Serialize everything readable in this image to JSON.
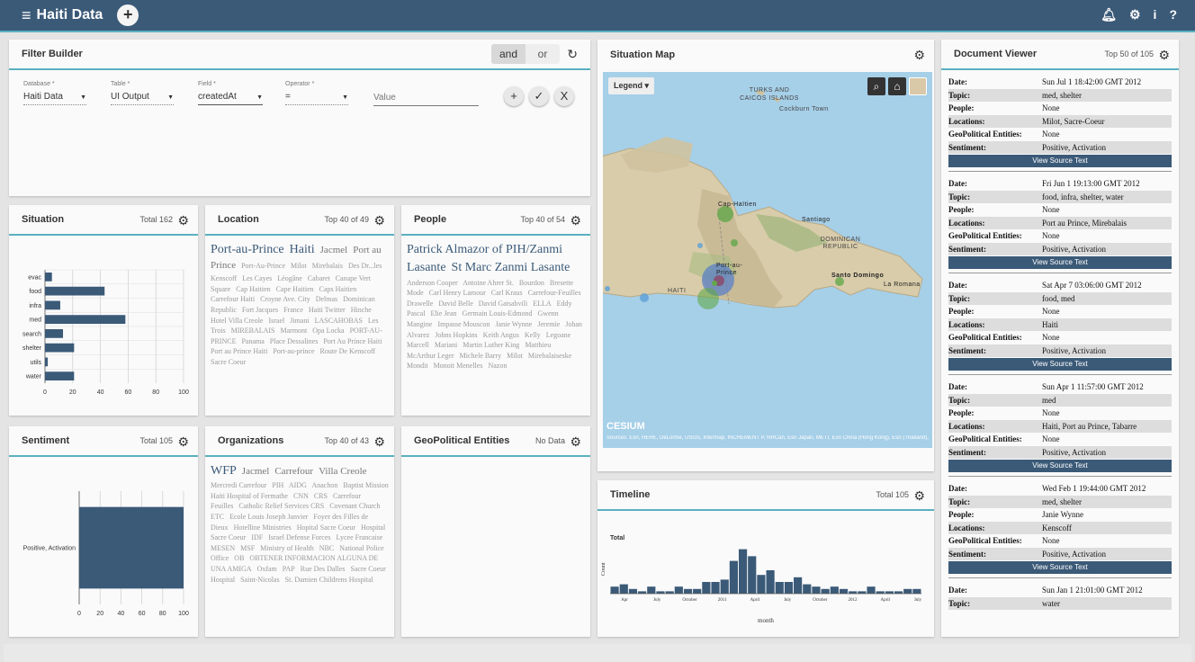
{
  "app": {
    "title": "Haiti Data",
    "menu_icon": "hamburger-icon",
    "add_label": "+",
    "right_icons": [
      "bell-icon",
      "gear-icon",
      "info-icon",
      "help-icon"
    ]
  },
  "filter": {
    "title": "Filter Builder",
    "and_label": "and",
    "or_label": "or",
    "database_label": "Database *",
    "database_value": "Haiti Data",
    "table_label": "Table *",
    "table_value": "UI Output",
    "field_label": "Field *",
    "field_value": "createdAt",
    "operator_label": "Operator *",
    "operator_value": "=",
    "value_placeholder": "Value",
    "add_label": "+",
    "apply_label": "✓",
    "clear_label": "X"
  },
  "situation": {
    "title": "Situation",
    "info": "Total 162",
    "chart_data": {
      "type": "bar",
      "orientation": "horizontal",
      "categories": [
        "evac",
        "food",
        "infra",
        "med",
        "search",
        "shelter",
        "utils",
        "water"
      ],
      "values": [
        5,
        43,
        11,
        58,
        13,
        21,
        2,
        21
      ],
      "xlim": [
        0,
        100
      ],
      "xticks": [
        0,
        20,
        40,
        60,
        80,
        100
      ],
      "color": "#3b5a78"
    }
  },
  "sentiment": {
    "title": "Sentiment",
    "info": "Total 105",
    "chart_data": {
      "type": "bar",
      "orientation": "horizontal",
      "categories": [
        "Positive, Activation"
      ],
      "values": [
        105
      ],
      "xlim": [
        0,
        100
      ],
      "xticks": [
        0,
        20,
        40,
        60,
        80,
        100
      ],
      "color": "#3b5a78"
    }
  },
  "location": {
    "title": "Location",
    "info": "Top 40 of 49",
    "big": [
      "Port-au-Prince",
      "Haiti"
    ],
    "mid": [
      "Jacmel",
      "Port au Prince"
    ],
    "small": [
      "Port-Au-Prince",
      "Milot",
      "Mirebalais",
      "Des Dr...les",
      "Kenscoff",
      "Les Cayes",
      "Léogâne",
      "Cabaret",
      "Canape Vert Square",
      "Cap Haitien",
      "Cape Haitien",
      "Caps Haitien",
      "Carrefour Haiti",
      "Croyne Ave. City",
      "Delmas",
      "Dominican Republic",
      "Fort Jacques",
      "France",
      "Haiti Twitter",
      "Hinche",
      "Hotel Villa Creole",
      "Israel",
      "Jimani",
      "LASCAHOBAS",
      "Les Trois",
      "MIREBALAIS",
      "Marmont",
      "Opa Locka",
      "PORT-AU-PRINCE",
      "Panama",
      "Place Dessalines",
      "Port Au Prince Haiti",
      "Port au Prince Haiti",
      "Port-au-prince",
      "Route De Kenscoff",
      "Sacre Coeur"
    ]
  },
  "people": {
    "title": "People",
    "info": "Top 40 of 54",
    "big": [
      "Patrick Almazor of PIH/Zanmi Lasante",
      "St Marc Zanmi Lasante"
    ],
    "small": [
      "Anderson Cooper",
      "Antoine Ahrer St.",
      "Bourdon",
      "Bresette Mode",
      "Carl Henry Lamour",
      "Carl Kraus",
      "Carrefour-Feuilles",
      "Drawelle",
      "David Belle",
      "David Gatsabvili",
      "ELLA",
      "Eddy Pascal",
      "Elie Jean",
      "Germain Louis-Edmond",
      "Gwenn Mangine",
      "Impasse Mouscon",
      "Janie Wynne",
      "Jeremie",
      "Johan Alvarez",
      "Johns Hopkins",
      "Keith Angus",
      "Kelly",
      "Legoane",
      "Marcell",
      "Mariani",
      "Martin Luther King",
      "Matthieu",
      "McArthur Leger",
      "Michele Barry",
      "Milot",
      "Mirebalaiseske",
      "Mondit",
      "Monoit Menelles",
      "Nazon"
    ]
  },
  "organizations": {
    "title": "Organizations",
    "info": "Top 40 of 43",
    "big": [
      "WFP"
    ],
    "mid": [
      "Jacmel",
      "Carrefour",
      "Villa Creole"
    ],
    "small": [
      "Mercredi Carrefour",
      "PIH",
      "AIDG",
      "Anachon",
      "Baptist Mission Haiti Hospital of Fermathe",
      "CNN",
      "CRS",
      "Carrefour Feuilles",
      "Catholic Relief Services CRS",
      "Covenant Church",
      "ETC",
      "Ecole Louis Joseph Janvier",
      "Foyer des Filles de Dieux",
      "Hotelline Ministries",
      "Hopital Sacre Coeur",
      "Hospital Sacre Coeur",
      "IDF",
      "Israel Defense Forces",
      "Lycee Francaise",
      "MESEN",
      "MSF",
      "Ministry of Health",
      "NBC",
      "National Police Office",
      "OB",
      "OBTENER INFORMACION ALGUNA DE UNA AMIGA",
      "Oxfam",
      "PAP",
      "Rue Des Dalles",
      "Sacre Coeur Hospital",
      "Saint-Nicolas",
      "St. Damien Childrens Hospital"
    ]
  },
  "geopolitical": {
    "title": "GeoPolitical Entities",
    "info": "No Data"
  },
  "map": {
    "title": "Situation Map",
    "legend_label": "Legend",
    "labels": [
      "TURKS AND CAICOS ISLANDS",
      "Cockburn Town",
      "Cap-Haïtien",
      "Santiago",
      "DOMINICAN REPUBLIC",
      "Port-au-Prince",
      "HAITI",
      "Santo Domingo",
      "La Romana"
    ],
    "brand": "CESIUM",
    "credits": "Sources: Esri, HERE, DeLorme, USGS, Intermap, INCREMENT P, NRCan, Esri Japan, METI, Esri China (Hong Kong), Esri (Thailand), MapmyIndia, © OpenStreetMap contributors, and the GIS User Community",
    "tool_icons": [
      "search-icon",
      "home-icon",
      "imagery-icon"
    ]
  },
  "timeline": {
    "title": "Timeline",
    "info": "Total 105",
    "chart_data": {
      "type": "bar",
      "series_name": "Total",
      "ylabel": "Count",
      "xlabel": "month",
      "tick_labels": [
        "Apr",
        "July",
        "October",
        "2011",
        "April",
        "July",
        "October",
        "2012",
        "April",
        "July"
      ],
      "values": [
        3,
        4,
        2,
        1,
        3,
        1,
        1,
        3,
        2,
        2,
        5,
        5,
        6,
        14,
        19,
        16,
        8,
        10,
        5,
        5,
        7,
        4,
        3,
        2,
        3,
        2,
        1,
        1,
        3,
        1,
        1,
        1,
        2,
        2
      ],
      "color": "#3b5a78"
    }
  },
  "documents": {
    "title": "Document Viewer",
    "info": "Top 50 of 105",
    "button_label": "View Source Text",
    "keys": [
      "Date:",
      "Topic:",
      "People:",
      "Locations:",
      "GeoPolitical Entities:",
      "Sentiment:"
    ],
    "items": [
      {
        "date": "Sun Jul 1 18:42:00 GMT 2012",
        "topic": "med, shelter",
        "people": "None",
        "locations": "Milot, Sacre-Coeur",
        "geo": "None",
        "sentiment": "Positive, Activation"
      },
      {
        "date": "Fri Jun 1 19:13:00 GMT 2012",
        "topic": "food, infra, shelter, water",
        "people": "None",
        "locations": "Port au Prince, Mirebalais",
        "geo": "None",
        "sentiment": "Positive, Activation"
      },
      {
        "date": "Sat Apr 7 03:06:00 GMT 2012",
        "topic": "food, med",
        "people": "None",
        "locations": "Haiti",
        "geo": "None",
        "sentiment": "Positive, Activation"
      },
      {
        "date": "Sun Apr 1 11:57:00 GMT 2012",
        "topic": "med",
        "people": "None",
        "locations": "Haiti, Port au Prince, Tabarre",
        "geo": "None",
        "sentiment": "Positive, Activation"
      },
      {
        "date": "Wed Feb 1 19:44:00 GMT 2012",
        "topic": "med, shelter",
        "people": "Janie Wynne",
        "locations": "Kenscoff",
        "geo": "None",
        "sentiment": "Positive, Activation"
      },
      {
        "date": "Sun Jan 1 21:01:00 GMT 2012",
        "topic": "water",
        "people": "",
        "locations": "",
        "geo": "",
        "sentiment": ""
      }
    ]
  }
}
